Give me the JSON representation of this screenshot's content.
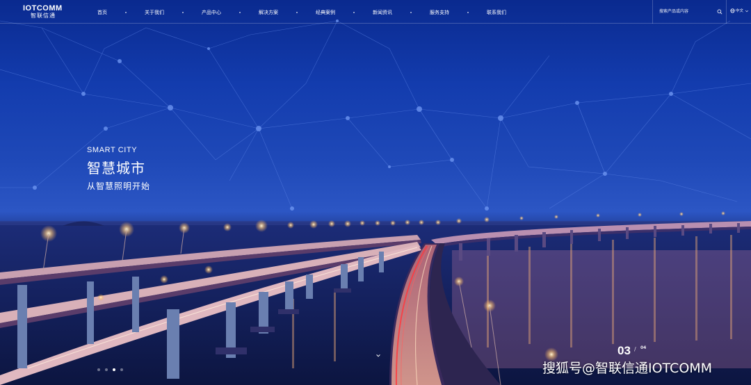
{
  "logo": {
    "en": "IOTCOMM",
    "cn": "智联信通"
  },
  "nav": [
    {
      "label": "首页"
    },
    {
      "label": "关于我们"
    },
    {
      "label": "产品中心"
    },
    {
      "label": "解决方案"
    },
    {
      "label": "经典案例"
    },
    {
      "label": "新闻资讯"
    },
    {
      "label": "服务支持"
    },
    {
      "label": "联系我们"
    }
  ],
  "search": {
    "placeholder": "搜索产品或内容"
  },
  "language": {
    "label": "中文"
  },
  "hero": {
    "title_en": "SMART CITY",
    "title_cn": "智慧城市",
    "subtitle": "从智慧照明开始"
  },
  "pager": {
    "current": "03",
    "separator": "/",
    "total": "04"
  },
  "watermark": "搜狐号@智联信通IOTCOMM",
  "colors": {
    "sky_top": "#0a2a8f",
    "sky_mid": "#2c56c4",
    "water": "#0f1c4e",
    "lamp": "#ffd9a0"
  }
}
